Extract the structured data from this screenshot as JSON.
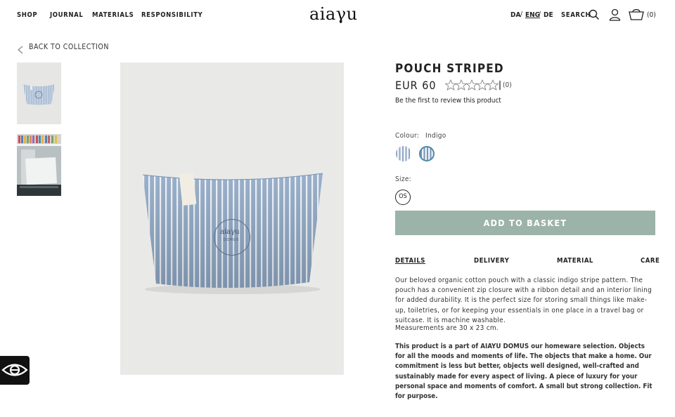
{
  "nav": {
    "links": [
      "SHOP",
      "JOURNAL",
      "MATERIALS",
      "RESPONSIBILITY"
    ],
    "logo": "aiaγu",
    "languages": [
      {
        "code": "DA",
        "active": false
      },
      {
        "code": "ENG",
        "active": true
      },
      {
        "code": "DE",
        "active": false
      }
    ],
    "lang_separator": "/",
    "search_label": "SEARCH",
    "basket_count": "(0)",
    "icons": [
      "search-icon",
      "user-icon",
      "basket-icon"
    ]
  },
  "back": {
    "label": "BACK TO COLLECTION",
    "icon": "chevron-left-icon"
  },
  "product": {
    "title": "POUCH STRIPED",
    "price": "EUR 60",
    "rating_stars": 0,
    "rating_max": 5,
    "review_count": "(0)",
    "review_link": "Be the first to review this product",
    "colour_label": "Colour:",
    "colour_value": "Indigo",
    "size_label": "Size:",
    "size_option": "OS",
    "add_to_basket": "ADD TO BASKET",
    "image_logo": "aiaγu",
    "image_logo_sub": "DOMUS"
  },
  "tabs": [
    {
      "label": "DETAILS",
      "active": true
    },
    {
      "label": "DELIVERY",
      "active": false
    },
    {
      "label": "MATERIAL",
      "active": false
    },
    {
      "label": "CARE",
      "active": false
    }
  ],
  "details": {
    "description": "Our beloved organic cotton pouch with a classic indigo stripe pattern.  The pouch has a convenient zip closure with a ribbon detail and an interior lining for added durability. It is the perfect size for storing small things like make-up, toiletries, or for keeping your essentials in one place in a travel bag or suitcase. It is machine washable.",
    "measurements": "Measurements are 30 x 23 cm.",
    "about": "This product is a part of AIAYU DOMUS our homeware selection. Objects for all the moods and moments of life. The objects that make a home. Our commitment is less but better, objects well designed, well-crafted and sustainably made for every aspect of living. A piece of luxury for your personal space and moments of comfort. A small but strong collection. Fit for purpose."
  },
  "colors": {
    "accent_button": "#9cb3a9",
    "swatch_selected_border": "#4f8aa8",
    "stripe_blue": "#8da6c4"
  }
}
